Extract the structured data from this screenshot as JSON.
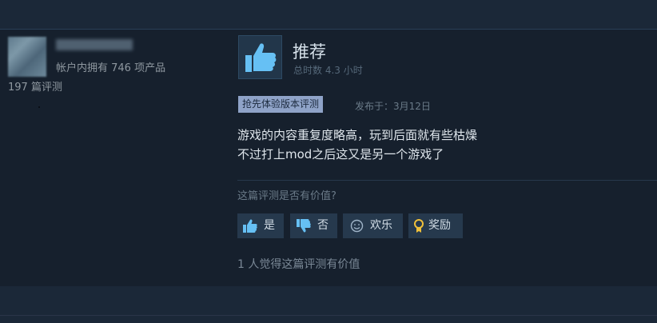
{
  "author": {
    "owned_label": "帐户内拥有 746 项产品",
    "reviews_label": "197 篇评测"
  },
  "review": {
    "verdict": "推荐",
    "playtime": "总时数 4.3 小时",
    "early_access_badge": "抢先体验版本评测",
    "posted": "发布于：3月12日",
    "lines": [
      "游戏的内容重复度略高，玩到后面就有些枯燥",
      "不过打上mod之后这又是另一个游戏了"
    ]
  },
  "feedback": {
    "question": "这篇评测是否有价值?",
    "buttons": {
      "yes": "是",
      "no": "否",
      "funny": "欢乐",
      "award": "奖励"
    },
    "helpful_count": "1 人觉得这篇评测有价值"
  },
  "colors": {
    "background": "#1b2838",
    "card": "#16202d",
    "button": "#26394d",
    "badge": "#8fa3c8",
    "thumb_icon": "#66c0f4",
    "award_icon": "#f0c03a"
  },
  "icons": {
    "recommend": "thumbs-up-icon",
    "yes": "thumbs-up-icon",
    "no": "thumbs-down-icon",
    "funny": "smiley-icon",
    "award": "award-ribbon-icon"
  }
}
